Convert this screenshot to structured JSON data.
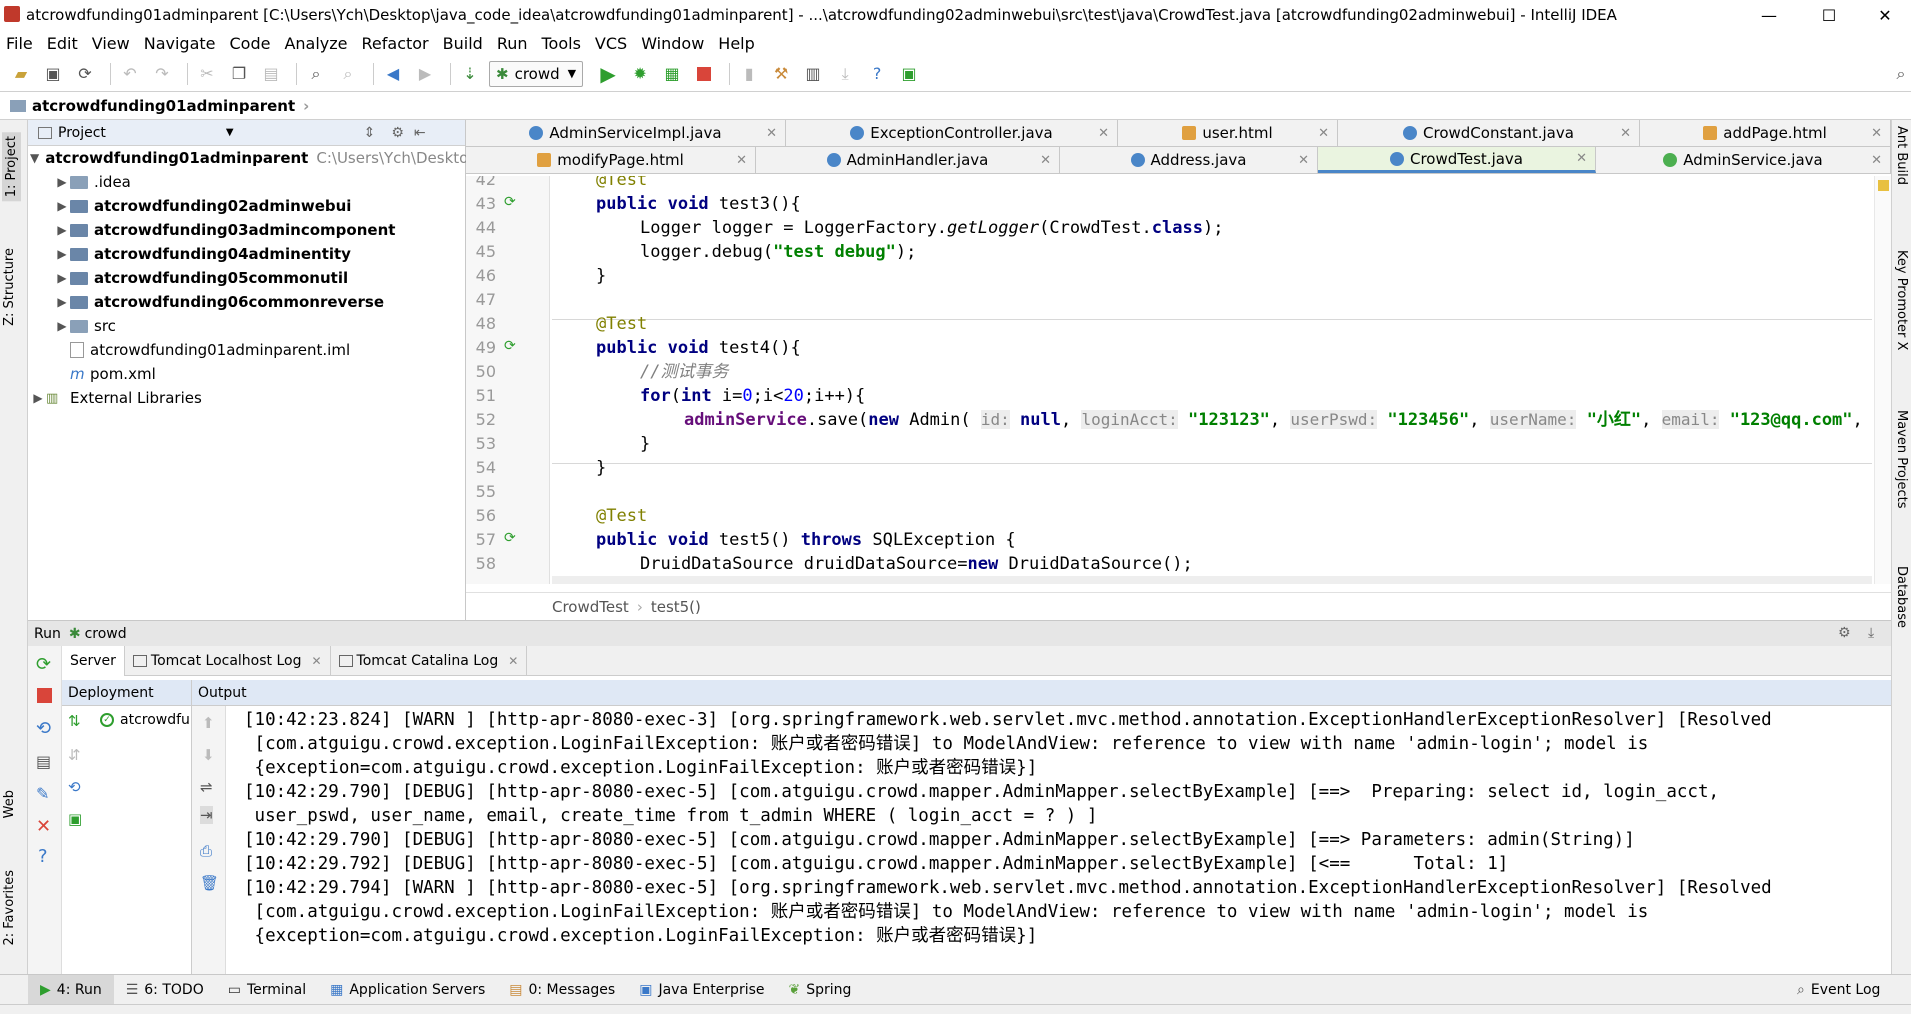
{
  "window": {
    "title": "atcrowdfunding01adminparent [C:\\Users\\Ych\\Desktop\\java_code_idea\\atcrowdfunding01adminparent] - ...\\atcrowdfunding02adminwebui\\src\\test\\java\\CrowdTest.java [atcrowdfunding02adminwebui] - IntelliJ IDEA",
    "minimize": "—",
    "maximize": "☐",
    "close": "✕"
  },
  "menu": [
    "File",
    "Edit",
    "View",
    "Navigate",
    "Code",
    "Analyze",
    "Refactor",
    "Build",
    "Run",
    "Tools",
    "VCS",
    "Window",
    "Help"
  ],
  "toolbar": {
    "run_config": "crowd"
  },
  "navbar": {
    "breadcrumb": "atcrowdfunding01adminparent"
  },
  "side_tabs": {
    "project": "1: Project",
    "structure": "Z: Structure",
    "web": "Web",
    "favorites": "2: Favorites"
  },
  "right_tabs": {
    "ant": "Ant Build",
    "key": "Key Promoter X",
    "maven": "Maven Projects",
    "db": "Database"
  },
  "project": {
    "header": "Project",
    "root": "atcrowdfunding01adminparent",
    "root_path": "C:\\Users\\Ych\\Deskto",
    "items": [
      {
        "label": ".idea",
        "bold": false,
        "type": "folder",
        "arrow": true
      },
      {
        "label": "atcrowdfunding02adminwebui",
        "bold": true,
        "type": "module",
        "arrow": true
      },
      {
        "label": "atcrowdfunding03admincomponent",
        "bold": true,
        "type": "module",
        "arrow": true
      },
      {
        "label": "atcrowdfunding04adminentity",
        "bold": true,
        "type": "module",
        "arrow": true
      },
      {
        "label": "atcrowdfunding05commonutil",
        "bold": true,
        "type": "module",
        "arrow": true
      },
      {
        "label": "atcrowdfunding06commonreverse",
        "bold": true,
        "type": "module",
        "arrow": true
      },
      {
        "label": "src",
        "bold": false,
        "type": "folder",
        "arrow": true
      },
      {
        "label": "atcrowdfunding01adminparent.iml",
        "bold": false,
        "type": "file",
        "arrow": false
      },
      {
        "label": "pom.xml",
        "bold": false,
        "type": "maven",
        "arrow": false
      }
    ],
    "external": "External Libraries"
  },
  "editor_tabs_row1": [
    {
      "label": "AdminServiceImpl.java",
      "icon": "C"
    },
    {
      "label": "ExceptionController.java",
      "icon": "C"
    },
    {
      "label": "user.html",
      "icon": "h"
    },
    {
      "label": "CrowdConstant.java",
      "icon": "C"
    },
    {
      "label": "addPage.html",
      "icon": "h"
    }
  ],
  "editor_tabs_row2": [
    {
      "label": "modifyPage.html",
      "icon": "h"
    },
    {
      "label": "AdminHandler.java",
      "icon": "C"
    },
    {
      "label": "Address.java",
      "icon": "C"
    },
    {
      "label": "CrowdTest.java",
      "icon": "C",
      "active": true
    },
    {
      "label": "AdminService.java",
      "icon": "I"
    }
  ],
  "code": {
    "line_numbers": [
      "42",
      "43",
      "44",
      "45",
      "46",
      "47",
      "48",
      "49",
      "50",
      "51",
      "52",
      "53",
      "54",
      "55",
      "56",
      "57",
      "58"
    ],
    "hints": {
      "id": "id:",
      "loginAcct": "loginAcct:",
      "userPswd": "userPswd:",
      "userName": "userName:",
      "email": "email:"
    },
    "strings": {
      "debug": "\"test debug\"",
      "acct": "\"123123\"",
      "pswd": "\"123456\"",
      "name": "\"小红\"",
      "mail": "\"123@qq.com\""
    },
    "comment": "//测试事务"
  },
  "breadcrumbs": {
    "cls": "CrowdTest",
    "method": "test5()"
  },
  "run": {
    "header": "Run",
    "config": "crowd",
    "tabs": [
      "Server",
      "Tomcat Localhost Log",
      "Tomcat Catalina Log"
    ],
    "deployment_header": "Deployment",
    "deployment_item": "atcrowdfu",
    "output_header": "Output",
    "output_lines": [
      "[10:42:23.824] [WARN ] [http-apr-8080-exec-3] [org.springframework.web.servlet.mvc.method.annotation.ExceptionHandlerExceptionResolver] [Resolved",
      " [com.atguigu.crowd.exception.LoginFailException: 账户或者密码错误] to ModelAndView: reference to view with name 'admin-login'; model is",
      " {exception=com.atguigu.crowd.exception.LoginFailException: 账户或者密码错误}]",
      "[10:42:29.790] [DEBUG] [http-apr-8080-exec-5] [com.atguigu.crowd.mapper.AdminMapper.selectByExample] [==>  Preparing: select id, login_acct,",
      " user_pswd, user_name, email, create_time from t_admin WHERE ( login_acct = ? ) ]",
      "[10:42:29.790] [DEBUG] [http-apr-8080-exec-5] [com.atguigu.crowd.mapper.AdminMapper.selectByExample] [==> Parameters: admin(String)]",
      "[10:42:29.792] [DEBUG] [http-apr-8080-exec-5] [com.atguigu.crowd.mapper.AdminMapper.selectByExample] [<==      Total: 1]",
      "[10:42:29.794] [WARN ] [http-apr-8080-exec-5] [org.springframework.web.servlet.mvc.method.annotation.ExceptionHandlerExceptionResolver] [Resolved",
      " [com.atguigu.crowd.exception.LoginFailException: 账户或者密码错误] to ModelAndView: reference to view with name 'admin-login'; model is",
      " {exception=com.atguigu.crowd.exception.LoginFailException: 账户或者密码错误}]"
    ]
  },
  "bottom_tabs": [
    {
      "label": "4: Run",
      "active": true
    },
    {
      "label": "6: TODO"
    },
    {
      "label": "Terminal"
    },
    {
      "label": "Application Servers"
    },
    {
      "label": "0: Messages"
    },
    {
      "label": "Java Enterprise"
    },
    {
      "label": "Spring"
    }
  ],
  "event_log": "Event Log"
}
